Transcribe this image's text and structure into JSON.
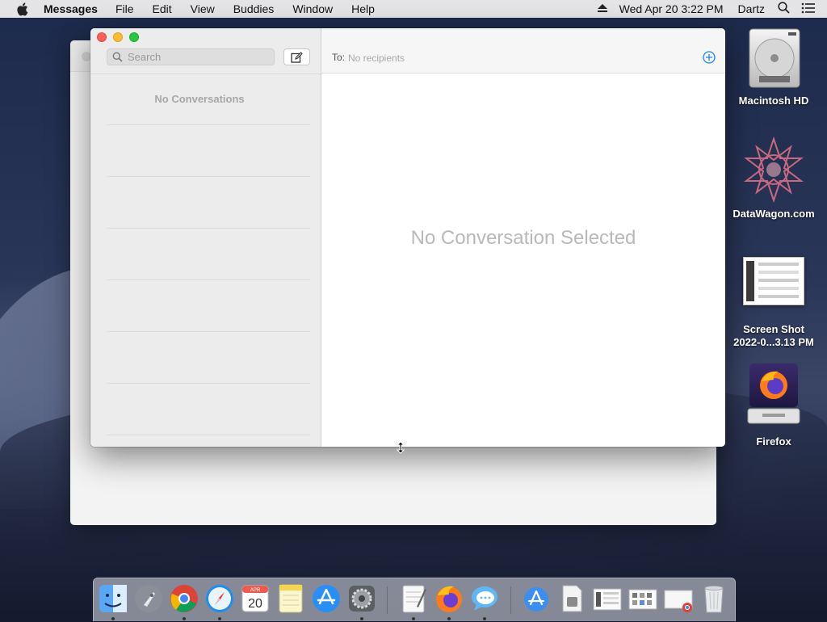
{
  "menubar": {
    "app_name": "Messages",
    "items": [
      "File",
      "Edit",
      "View",
      "Buddies",
      "Window",
      "Help"
    ],
    "clock": "Wed Apr 20  3:22 PM",
    "user": "Dartz"
  },
  "messages_window": {
    "search_placeholder": "Search",
    "no_conversations_label": "No Conversations",
    "to_label": "To:",
    "to_placeholder": "No recipients",
    "empty_state": "No Conversation Selected"
  },
  "desktop_icons": [
    {
      "label": "Macintosh HD",
      "icon": "hard-drive-icon"
    },
    {
      "label": "DataWagon.com",
      "icon": "datawagon-logo-icon"
    },
    {
      "label": "Screen Shot 2022-0...3.13 PM",
      "icon": "screenshot-thumbnail"
    },
    {
      "label": "Firefox",
      "icon": "firefox-installer-icon"
    }
  ],
  "dock": {
    "apps": [
      "Finder",
      "Launchpad",
      "Google Chrome",
      "Safari",
      "Calendar",
      "Notes",
      "App Store",
      "System Preferences",
      "TextEdit",
      "Firefox",
      "Messages"
    ],
    "calendar_month": "APR",
    "calendar_day": "20"
  },
  "colors": {
    "traffic_close": "#fc5f57",
    "traffic_minimize": "#fdbc2e",
    "traffic_maximize": "#28c840",
    "accent_blue": "#1a82fb"
  }
}
